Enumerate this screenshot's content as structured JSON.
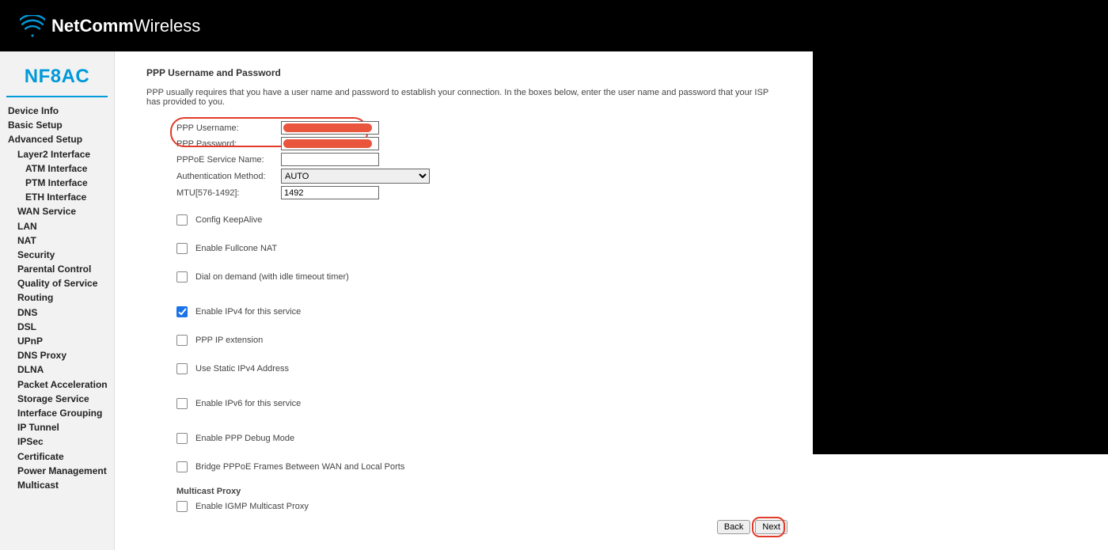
{
  "brand": {
    "name_bold": "NetComm",
    "name_light": "Wireless"
  },
  "product": "NF8AC",
  "nav": {
    "device_info": "Device Info",
    "basic_setup": "Basic Setup",
    "advanced_setup": "Advanced Setup",
    "layer2": "Layer2 Interface",
    "atm": "ATM Interface",
    "ptm": "PTM Interface",
    "eth": "ETH Interface",
    "wan": "WAN Service",
    "lan": "LAN",
    "nat": "NAT",
    "security": "Security",
    "parental": "Parental Control",
    "qos": "Quality of Service",
    "routing": "Routing",
    "dns": "DNS",
    "dsl": "DSL",
    "upnp": "UPnP",
    "dnsproxy": "DNS Proxy",
    "dlna": "DLNA",
    "packet": "Packet Acceleration",
    "storage": "Storage Service",
    "ifgroup": "Interface Grouping",
    "iptunnel": "IP Tunnel",
    "ipsec": "IPSec",
    "cert": "Certificate",
    "power": "Power Management",
    "multicast": "Multicast"
  },
  "page": {
    "title": "PPP Username and Password",
    "desc": "PPP usually requires that you have a user name and password to establish your connection. In the boxes below, enter the user name and password that your ISP has provided to you."
  },
  "fields": {
    "ppp_username_label": "PPP Username:",
    "ppp_password_label": "PPP Password:",
    "pppoe_service_label": "PPPoE Service Name:",
    "auth_method_label": "Authentication Method:",
    "auth_method_value": "AUTO",
    "mtu_label": "MTU[576-1492]:",
    "mtu_value": "1492"
  },
  "checks": {
    "keepalive": "Config KeepAlive",
    "fullcone": "Enable Fullcone NAT",
    "dialondemand": "Dial on demand (with idle timeout timer)",
    "ipv4": "Enable IPv4 for this service",
    "pppip": "PPP IP extension",
    "staticv4": "Use Static IPv4 Address",
    "ipv6": "Enable IPv6 for this service",
    "debug": "Enable PPP Debug Mode",
    "bridge": "Bridge PPPoE Frames Between WAN and Local Ports",
    "multicast_title": "Multicast Proxy",
    "igmp": "Enable IGMP Multicast Proxy"
  },
  "buttons": {
    "back": "Back",
    "next": "Next"
  }
}
